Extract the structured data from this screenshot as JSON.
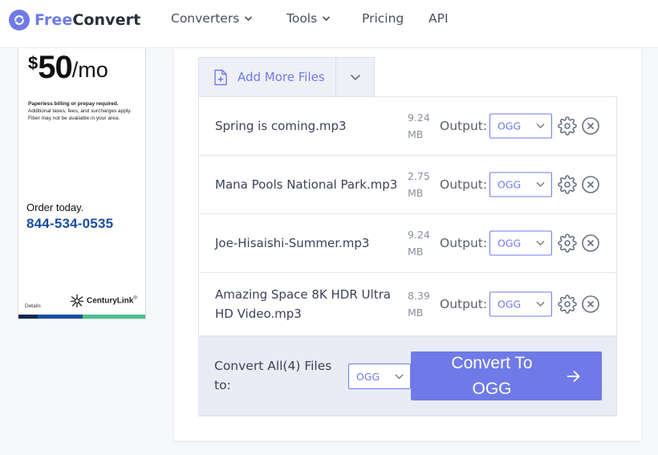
{
  "header": {
    "brand_free": "Free",
    "brand_convert": "Convert",
    "nav": [
      {
        "label": "Converters",
        "dropdown": true
      },
      {
        "label": "Tools",
        "dropdown": true
      },
      {
        "label": "Pricing",
        "dropdown": false
      },
      {
        "label": "API",
        "dropdown": false
      }
    ]
  },
  "ad": {
    "dollar": "$",
    "amount": "50",
    "per": "/mo",
    "fine_bold": "Paperless billing or prepay required.",
    "fine_1": "Additional taxes, fees, and surcharges apply.",
    "fine_2": "Fiber may not be available in your area.",
    "order": "Order today.",
    "phone": "844-534-0535",
    "details": "Details",
    "brand": "CenturyLink",
    "brand_mark": "®"
  },
  "add_files": {
    "label": "Add More Files",
    "icon": "file-plus-icon"
  },
  "files": [
    {
      "name": "Spring is coming.mp3",
      "size_value": "9.24",
      "size_unit": "MB",
      "output_label": "Output:",
      "format": "OGG"
    },
    {
      "name": "Mana Pools National Park.mp3",
      "size_value": "2.75",
      "size_unit": "MB",
      "output_label": "Output:",
      "format": "OGG"
    },
    {
      "name": "Joe-Hisaishi-Summer.mp3",
      "size_value": "9.24",
      "size_unit": "MB",
      "output_label": "Output:",
      "format": "OGG"
    },
    {
      "name": "Amazing Space 8K HDR Ultra HD Video.mp3",
      "size_value": "8.39",
      "size_unit": "MB",
      "output_label": "Output:",
      "format": "OGG"
    }
  ],
  "convert": {
    "label": "Convert All(4) Files to:",
    "format": "OGG",
    "button_label": "Convert To OGG"
  },
  "colors": {
    "accent": "#6f7ae8",
    "text": "#3c4257",
    "muted": "#8a8f9c",
    "convert_bar": "#e9ebf5",
    "ad_phone": "#1b4ea3"
  }
}
